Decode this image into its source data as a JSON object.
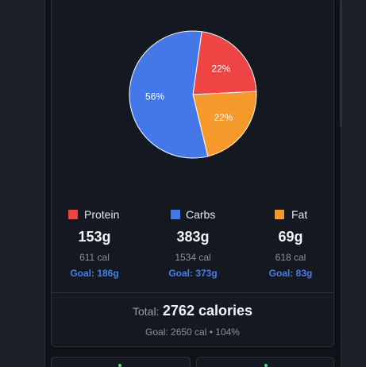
{
  "chart_data": {
    "type": "pie",
    "categories": [
      "Protein",
      "Carbs",
      "Fat"
    ],
    "values": [
      22,
      56,
      22
    ],
    "labels": [
      "22%",
      "56%",
      "22%"
    ],
    "colors": [
      "#ef4444",
      "#4478e8",
      "#f59a2a"
    ]
  },
  "macros": [
    {
      "name": "Protein",
      "grams": "153g",
      "cal": "611 cal",
      "goal": "Goal: 186g",
      "color": "#ef4444"
    },
    {
      "name": "Carbs",
      "grams": "383g",
      "cal": "1534 cal",
      "goal": "Goal: 373g",
      "color": "#4478e8"
    },
    {
      "name": "Fat",
      "grams": "69g",
      "cal": "618 cal",
      "goal": "Goal: 83g",
      "color": "#f59a2a"
    }
  ],
  "total": {
    "label": "Total:",
    "value": "2762 calories",
    "goal_line": "Goal: 2650 cal • 104%"
  }
}
